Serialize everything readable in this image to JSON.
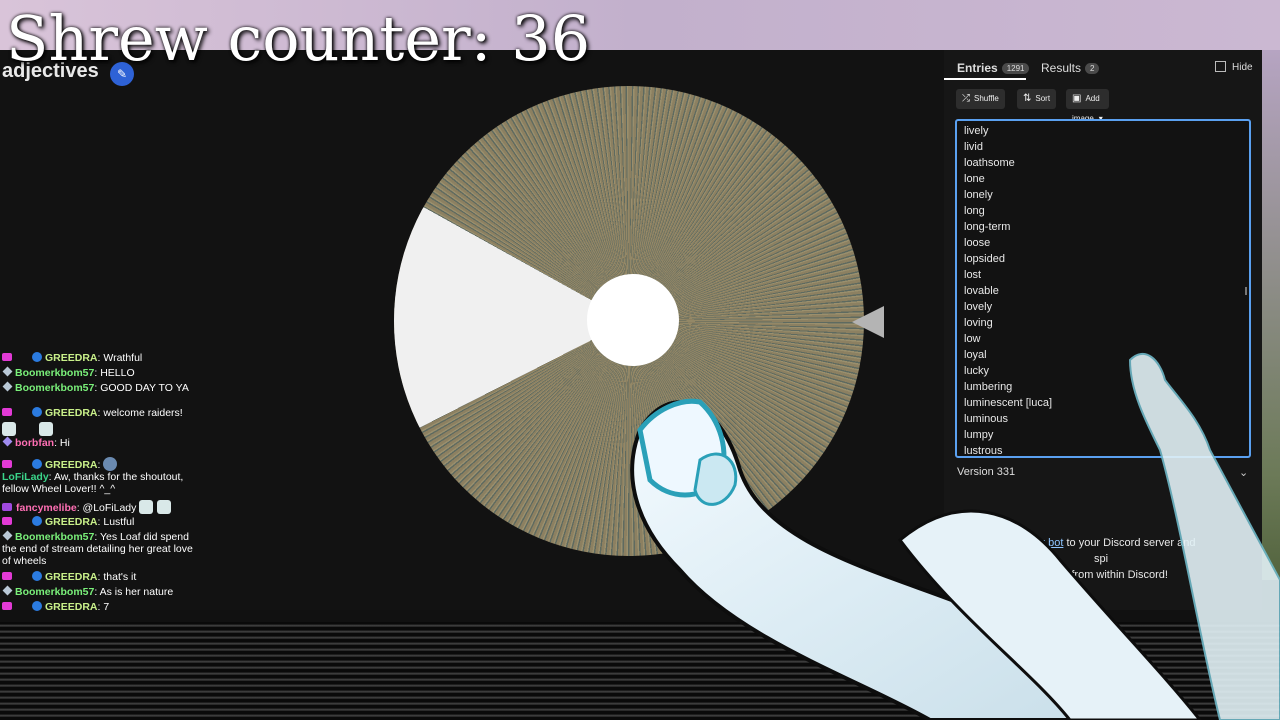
{
  "overlay": {
    "counter_text": "Shrew counter: 36"
  },
  "wheel": {
    "title": "adjectives",
    "segment_count_shown": 1291
  },
  "tabs": [
    {
      "label": "Entries",
      "count": "1291",
      "active": true
    },
    {
      "label": "Results",
      "count": "2",
      "active": false
    }
  ],
  "hide": {
    "label": "Hide",
    "checked": false
  },
  "toolbar": {
    "shuffle": "Shuffle",
    "sort": "Sort",
    "add_image": "Add image"
  },
  "entries": [
    "lively",
    "livid",
    "loathsome",
    "lone",
    "lonely",
    "long",
    "long-term",
    "loose",
    "lopsided",
    "lost",
    "lovable",
    "lovely",
    "loving",
    "low",
    "loyal",
    "lucky",
    "lumbering",
    "luminescent [luca]",
    "luminous",
    "lumpy",
    "lustrous"
  ],
  "version": "Version 331",
  "discord": {
    "link": "Add our bot",
    "text_a": "to your Discord server and spi",
    "text_b": "wheels from within Discord!"
  },
  "chat": [
    {
      "badge": "heart",
      "verified": true,
      "user": "GREEDRA",
      "color": "u-yellow",
      "text": "Wrathful"
    },
    {
      "badge": "diamond",
      "verified": false,
      "user": "Boomerkbom57",
      "color": "u-green",
      "text": "HELLO"
    },
    {
      "badge": "diamond",
      "verified": false,
      "user": "Boomerkbom57",
      "color": "u-green",
      "text": "GOOD DAY TO YA"
    },
    {
      "badge": "heart",
      "verified": true,
      "user": "GREEDRA",
      "color": "u-yellow",
      "text": "welcome raiders!"
    },
    {
      "badge": "emote",
      "verified": false,
      "user": "borbfan",
      "color": "u-pink",
      "text": "Hi"
    },
    {
      "badge": "heart",
      "verified": true,
      "user": "GREEDRA",
      "color": "u-yellow",
      "text": ""
    },
    {
      "badge": "none",
      "verified": false,
      "user": "LoFiLady",
      "color": "u-teal",
      "text": "Aw, thanks for the shoutout, fellow Wheel Lover!! ^_^"
    },
    {
      "badge": "bits",
      "verified": false,
      "user": "fancymelibe",
      "color": "u-pink",
      "text": "@LoFiLady"
    },
    {
      "badge": "heart",
      "verified": true,
      "user": "GREEDRA",
      "color": "u-yellow",
      "text": "Lustful"
    },
    {
      "badge": "diamond",
      "verified": false,
      "user": "Boomerkbom57",
      "color": "u-green",
      "text": "Yes Loaf did spend the end of stream detailing her great love of wheels"
    },
    {
      "badge": "heart",
      "verified": true,
      "user": "GREEDRA",
      "color": "u-yellow",
      "text": "that's it"
    },
    {
      "badge": "diamond",
      "verified": false,
      "user": "Boomerkbom57",
      "color": "u-green",
      "text": "As is her nature"
    },
    {
      "badge": "heart",
      "verified": true,
      "user": "GREEDRA",
      "color": "u-yellow",
      "text": "7"
    }
  ]
}
